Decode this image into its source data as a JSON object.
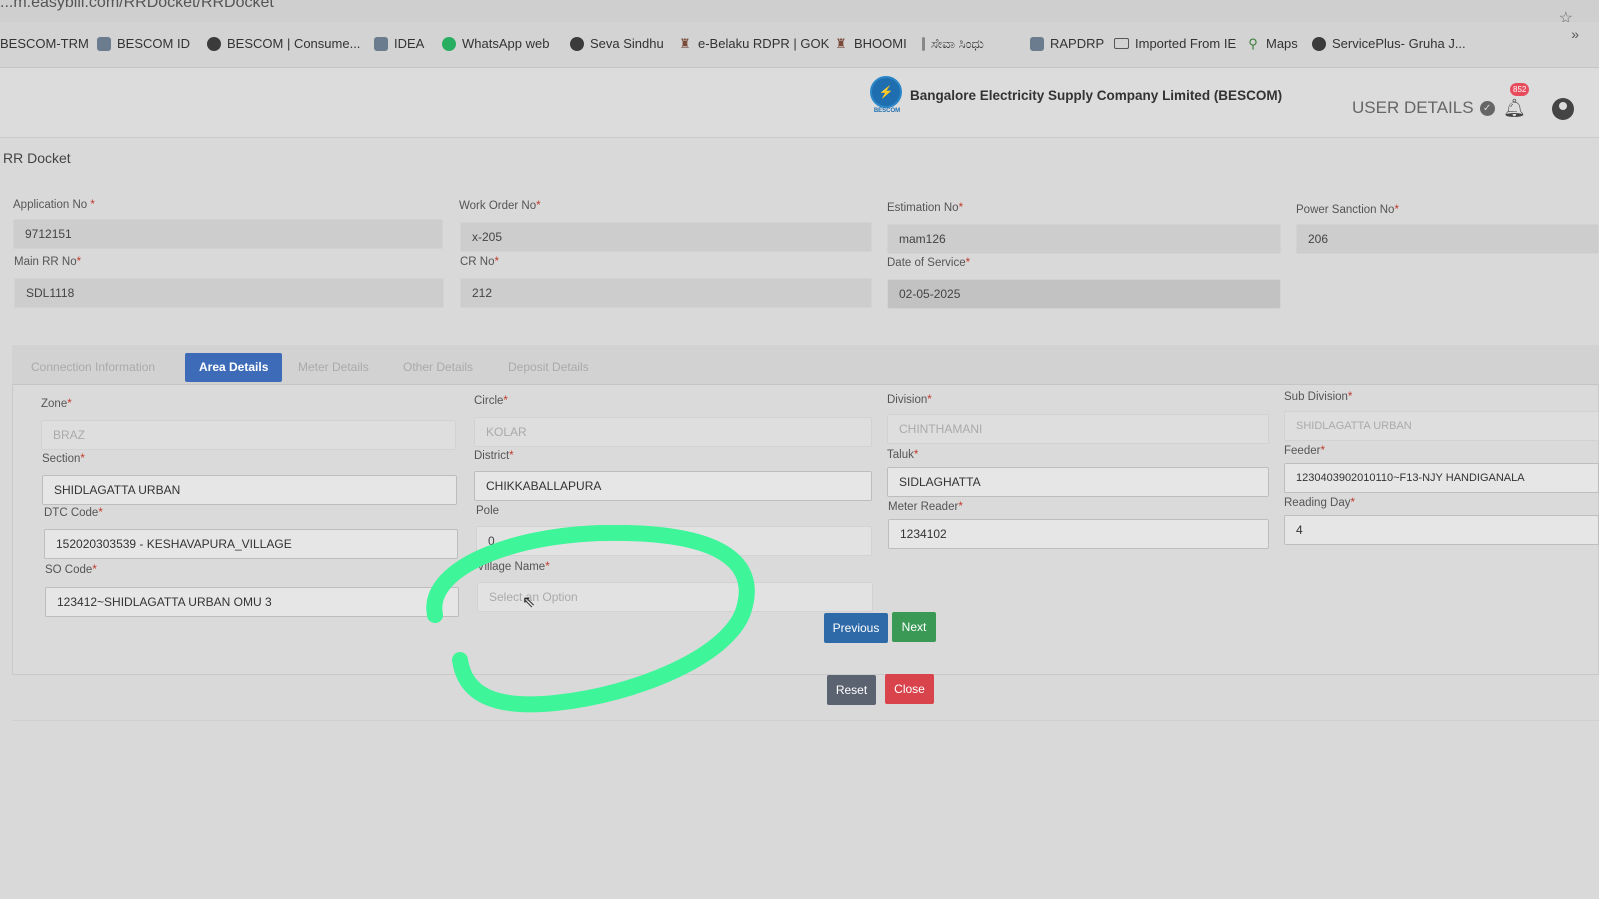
{
  "browser": {
    "url": "...m.easybill.com/RRDocket/RRDocket",
    "bookmarks": [
      {
        "label": "BESCOM-TRM"
      },
      {
        "label": "BESCOM ID"
      },
      {
        "label": "BESCOM | Consume..."
      },
      {
        "label": "IDEA"
      },
      {
        "label": "WhatsApp web"
      },
      {
        "label": "Seva Sindhu"
      },
      {
        "label": "e-Belaku RDPR | GOK"
      },
      {
        "label": "BHOOMI"
      },
      {
        "label": "ಸೇವಾ ಸಿಂಧು"
      },
      {
        "label": "RAPDRP"
      },
      {
        "label": "Imported From IE"
      },
      {
        "label": "Maps"
      },
      {
        "label": "ServicePlus- Gruha J..."
      }
    ],
    "more": "»"
  },
  "header": {
    "logo_text": "BESCOM",
    "company": "Bangalore Electricity Supply Company Limited (BESCOM)",
    "user_details": "USER DETAILS",
    "badge": "852"
  },
  "page": {
    "title": "RR Docket"
  },
  "top_fields": {
    "application_no": {
      "label": "Application No",
      "value": "9712151"
    },
    "work_order_no": {
      "label": "Work Order No",
      "value": "x-205"
    },
    "estimation_no": {
      "label": "Estimation No",
      "value": "mam126"
    },
    "power_sanction_no": {
      "label": "Power Sanction No",
      "value": "206"
    },
    "main_rr_no": {
      "label": "Main RR No",
      "value": "SDL1118"
    },
    "cr_no": {
      "label": "CR No",
      "value": "212"
    },
    "date_of_service": {
      "label": "Date of Service",
      "value": "02-05-2025"
    }
  },
  "tabs": [
    {
      "label": "Connection Information"
    },
    {
      "label": "Area Details"
    },
    {
      "label": "Meter Details"
    },
    {
      "label": "Other Details"
    },
    {
      "label": "Deposit Details"
    }
  ],
  "area": {
    "zone": {
      "label": "Zone",
      "value": "BRAZ"
    },
    "circle": {
      "label": "Circle",
      "value": "KOLAR"
    },
    "division": {
      "label": "Division",
      "value": "CHINTHAMANI"
    },
    "sub_division": {
      "label": "Sub Division",
      "value": "SHIDLAGATTA URBAN"
    },
    "section": {
      "label": "Section",
      "value": "SHIDLAGATTA URBAN"
    },
    "district": {
      "label": "District",
      "value": "CHIKKABALLAPURA"
    },
    "taluk": {
      "label": "Taluk",
      "value": "SIDLAGHATTA"
    },
    "feeder": {
      "label": "Feeder",
      "value": "1230403902010110~F13-NJY HANDIGANALA"
    },
    "dtc_code": {
      "label": "DTC Code",
      "value": "152020303539 - KESHAVAPURA_VILLAGE"
    },
    "pole": {
      "label": "Pole",
      "value": "0"
    },
    "meter_reader": {
      "label": "Meter Reader",
      "value": "1234102"
    },
    "reading_day": {
      "label": "Reading Day",
      "value": "4"
    },
    "so_code": {
      "label": "SO Code",
      "value": "123412~SHIDLAGATTA URBAN OMU 3"
    },
    "village_name": {
      "label": "Village Name",
      "placeholder": "Select an Option"
    }
  },
  "buttons": {
    "previous": "Previous",
    "next": "Next",
    "reset": "Reset",
    "close": "Close"
  },
  "annotation_color": "#3ef59a"
}
